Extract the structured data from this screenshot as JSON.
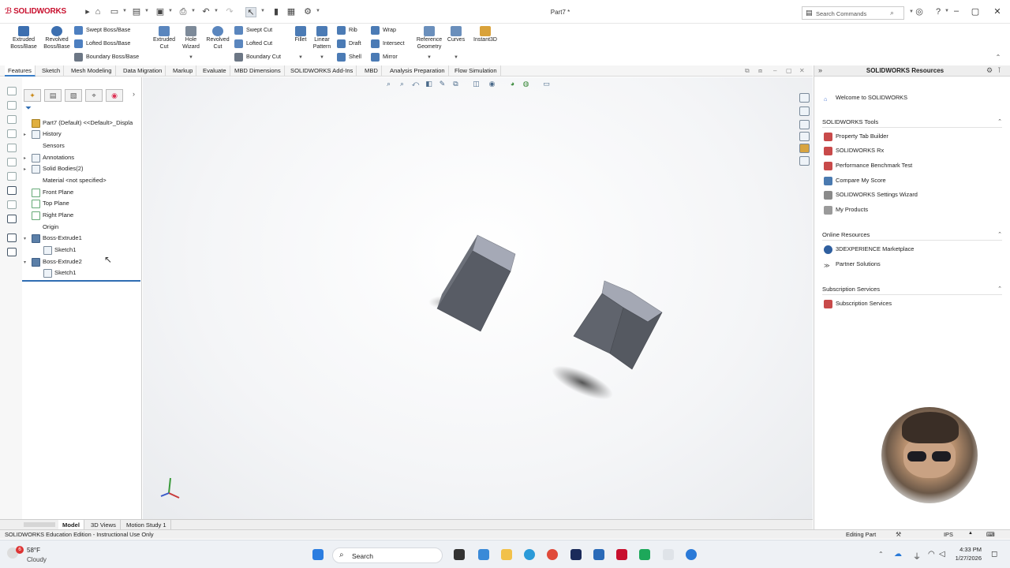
{
  "app": {
    "brand": "SOLIDWORKS",
    "doc_title": "Part7 *"
  },
  "titlebar": {
    "search_placeholder": "Search Commands"
  },
  "ribbon": {
    "extruded_boss": "Extruded\nBoss/Base",
    "revolved_boss": "Revolved\nBoss/Base",
    "swept_boss": "Swept Boss/Base",
    "lofted_boss": "Lofted Boss/Base",
    "boundary_boss": "Boundary Boss/Base",
    "extruded_cut": "Extruded\nCut",
    "hole_wizard": "Hole\nWizard",
    "revolved_cut": "Revolved\nCut",
    "swept_cut": "Swept Cut",
    "lofted_cut": "Lofted Cut",
    "boundary_cut": "Boundary Cut",
    "fillet": "Fillet",
    "linear_pattern": "Linear\nPattern",
    "rib": "Rib",
    "draft": "Draft",
    "shell": "Shell",
    "wrap": "Wrap",
    "intersect": "Intersect",
    "mirror": "Mirror",
    "reference_geometry": "Reference\nGeometry",
    "curves": "Curves",
    "instant3d": "Instant3D"
  },
  "tabs": [
    "Features",
    "Sketch",
    "Mesh Modeling",
    "Data Migration",
    "Markup",
    "Evaluate",
    "MBD Dimensions",
    "SOLIDWORKS Add-Ins",
    "MBD",
    "Analysis Preparation",
    "Flow Simulation"
  ],
  "tree": {
    "root": "Part7 (Default) <<Default>_Displa",
    "items": [
      "History",
      "Sensors",
      "Annotations",
      "Solid Bodies(2)",
      "Material <not specified>",
      "Front Plane",
      "Top Plane",
      "Right Plane",
      "Origin",
      "Boss-Extrude1",
      "Sketch1",
      "Boss-Extrude2",
      "Sketch1"
    ]
  },
  "bottom_tabs": [
    "Model",
    "3D Views",
    "Motion Study 1"
  ],
  "status": {
    "left": "SOLIDWORKS Education Edition - Instructional Use Only",
    "mode": "Editing Part",
    "units": "IPS"
  },
  "taskpane": {
    "title": "SOLIDWORKS Resources",
    "welcome": "Welcome to SOLIDWORKS",
    "tools_header": "SOLIDWORKS Tools",
    "tools": [
      "Property Tab Builder",
      "SOLIDWORKS Rx",
      "Performance Benchmark Test",
      "Compare My Score",
      "SOLIDWORKS Settings Wizard",
      "My Products"
    ],
    "online_header": "Online Resources",
    "online": [
      "3DEXPERIENCE Marketplace",
      "Partner Solutions"
    ],
    "subs_header": "Subscription Services",
    "subs": [
      "Subscription Services"
    ]
  },
  "taskbar": {
    "temp": "58°F",
    "weather": "Cloudy",
    "search": "Search",
    "time": "4:33 PM",
    "date": "1/27/2026",
    "badge": "6"
  },
  "colors": {
    "brand": "#c8102e",
    "accent": "#2f6db3",
    "body_top": "#a4a8b4",
    "body_side": "#5b5f68"
  }
}
